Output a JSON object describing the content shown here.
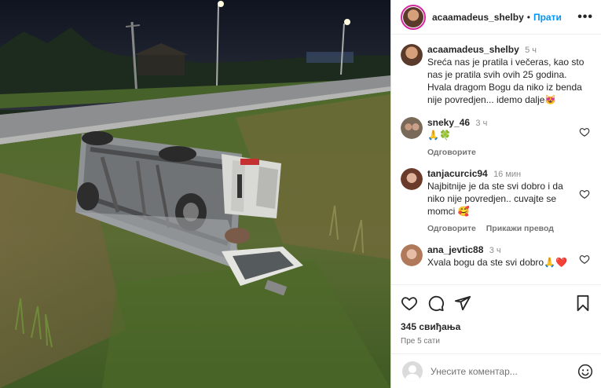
{
  "post": {
    "author": "acaamadeus_shelby",
    "follow_label": "Прати",
    "more_icon": "more-horizontal-icon",
    "photo_alt": ""
  },
  "caption": {
    "user": "acaamadeus_shelby",
    "time": "5 ч",
    "text": "Sreća nas je pratila i večeras, kao sto nas je pratila svih ovih 25 godina. Hvala dragom Bogu da niko iz benda nije povredjen... idemo dalje😻"
  },
  "comments": [
    {
      "user": "sneky_46",
      "time": "3 ч",
      "text": "🙏🍀",
      "actions": [
        "Одговорите"
      ]
    },
    {
      "user": "tanjacurcic94",
      "time": "16 мин",
      "text": "Najbitnije je da ste svi dobro i da niko nije povredjen.. cuvajte se momci 🥰",
      "actions": [
        "Одговорите",
        "Прикажи превод"
      ]
    },
    {
      "user": "ana_jevtic88",
      "time": "3 ч",
      "text": "Xvala bogu da ste svi dobro🙏❤️",
      "actions": []
    }
  ],
  "stats": {
    "likes": "345 свиђања",
    "posted": "Пре 5 сати"
  },
  "composer": {
    "placeholder": "Унесите коментар..."
  },
  "colors": {
    "link": "#0095f6",
    "muted": "#737373",
    "border": "#dbdbdb"
  }
}
